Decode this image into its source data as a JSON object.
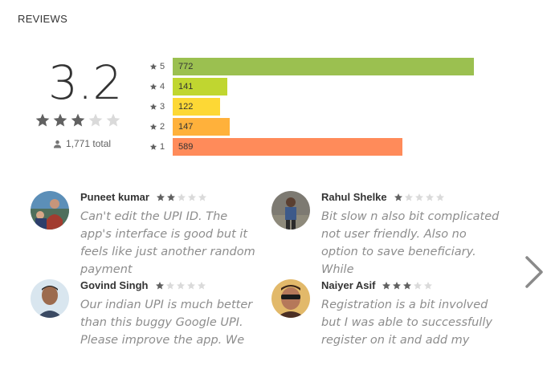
{
  "section": {
    "title": "REVIEWS"
  },
  "rating": {
    "score": "3.2",
    "stars_filled": 3,
    "stars_total": 5,
    "total": "1,771 total"
  },
  "histogram": [
    {
      "label": "5",
      "count": "772",
      "value": 772,
      "color": "#9bc050"
    },
    {
      "label": "4",
      "count": "141",
      "value": 141,
      "color": "#c0d630"
    },
    {
      "label": "3",
      "count": "122",
      "value": 122,
      "color": "#fdd835"
    },
    {
      "label": "2",
      "count": "147",
      "value": 147,
      "color": "#ffb13b"
    },
    {
      "label": "1",
      "count": "589",
      "value": 589,
      "color": "#ff8b5a"
    }
  ],
  "reviews": [
    {
      "author": "Puneet kumar",
      "stars": 2,
      "text": "Can't edit the UPI ID. The app's interface is good but it feels like just another random payment"
    },
    {
      "author": "Rahul Shelke",
      "stars": 1,
      "text": "Bit slow n also bit complicated not user friendly. Also no option to save beneficiary. While"
    },
    {
      "author": "Govind Singh",
      "stars": 1,
      "text": "Our indian UPI is much better than this buggy Google UPI. Please improve the app. We"
    },
    {
      "author": "Naiyer Asif",
      "stars": 3,
      "text": "Registration is a bit involved but I was able to successfully register on it and add my"
    }
  ],
  "icons": {
    "next": "chevron-right-icon",
    "user": "person-icon",
    "star": "star-icon"
  },
  "colors": {
    "star_filled": "#616161",
    "star_empty": "#dadada"
  }
}
